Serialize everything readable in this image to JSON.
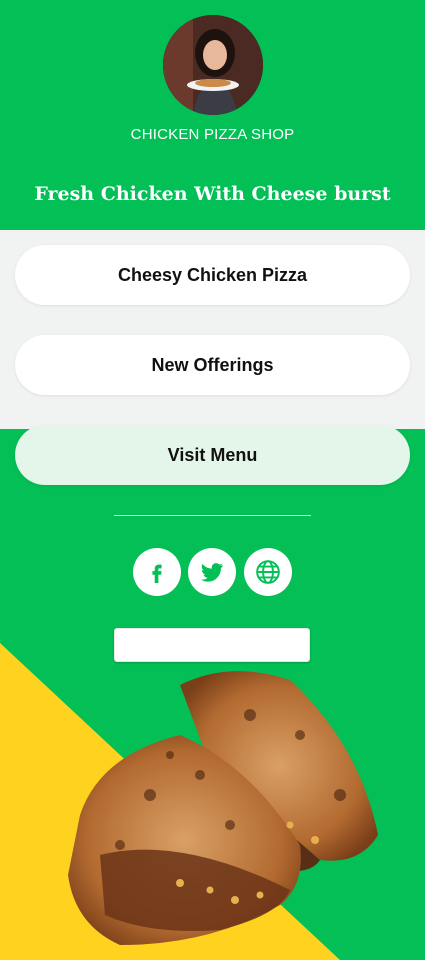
{
  "header": {
    "shop_name": "CHICKEN PIZZA SHOP",
    "tagline": "Fresh Chicken With Cheese burst"
  },
  "links": [
    {
      "label": "Cheesy Chicken Pizza"
    },
    {
      "label": "New Offerings"
    },
    {
      "label": "Visit Menu"
    }
  ],
  "social": [
    {
      "icon": "facebook-icon"
    },
    {
      "icon": "twitter-icon"
    },
    {
      "icon": "globe-icon"
    }
  ],
  "colors": {
    "brand_green": "#02c055",
    "band_grey": "#f1f3f2",
    "accent_yellow": "#ffd21f",
    "social_icon_green": "#02c055"
  }
}
